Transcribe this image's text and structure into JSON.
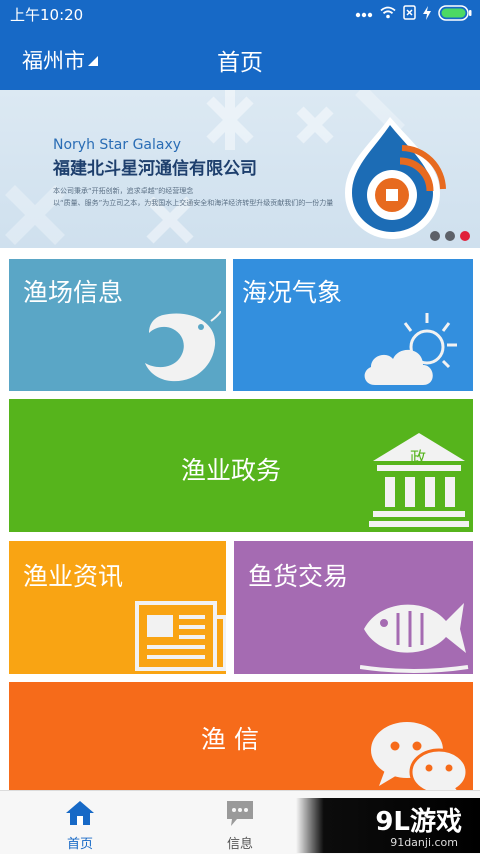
{
  "status_bar": {
    "time": "上午10:20",
    "icons": [
      "signal-dots-icon",
      "wifi-icon",
      "sim-icon",
      "charging-icon",
      "battery-icon"
    ]
  },
  "app_bar": {
    "city": "福州市",
    "title": "首页"
  },
  "banner": {
    "company_en": "Noryh Star Galaxy",
    "company_cn": "福建北斗星河通信有限公司",
    "line1": "本公司秉承“开拓创新，追求卓越”的经营理念",
    "line2": "以“质量、服务”为立司之本，为我国水上交通安全和海洋经济转型升级贡献我们的一份力量",
    "page_count": 3,
    "active_page": 3
  },
  "tiles": {
    "fishing_info": {
      "label": "渔场信息",
      "color": "#5aa6c6",
      "icon": "shrimp-icon"
    },
    "weather": {
      "label": "海况气象",
      "color": "#338fde",
      "icon": "weather-icon"
    },
    "government": {
      "label": "渔业政务",
      "color": "#56b41c",
      "icon": "government-building-icon",
      "icon_text": "政"
    },
    "news": {
      "label": "渔业资讯",
      "color": "#f9a413",
      "icon": "newspaper-icon"
    },
    "trade": {
      "label": "鱼货交易",
      "color": "#a56bb2",
      "icon": "fish-icon"
    },
    "messenger": {
      "label": "渔 信",
      "color": "#f66b1a",
      "icon": "chat-bubbles-icon"
    }
  },
  "tab_bar": {
    "home": {
      "label": "首页",
      "active": true,
      "color": "#1769c6"
    },
    "messages": {
      "label": "信息",
      "active": false,
      "color": "#555555"
    }
  },
  "watermark": {
    "main": "9L游戏",
    "sub": "91danji.com"
  }
}
